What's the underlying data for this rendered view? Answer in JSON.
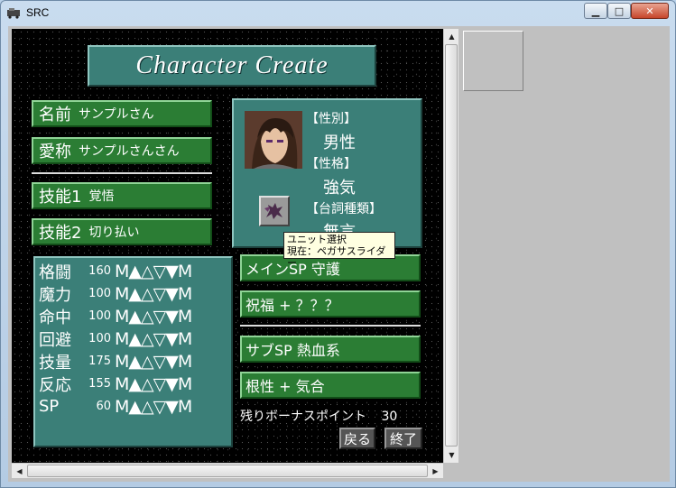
{
  "window": {
    "title": "SRC"
  },
  "header": {
    "title": "Character Create"
  },
  "profile": {
    "name_label": "名前",
    "name_value": "サンプルさん",
    "nickname_label": "愛称",
    "nickname_value": "サンプルさんさん",
    "skill1_label": "技能1",
    "skill1_value": "覚悟",
    "skill2_label": "技能2",
    "skill2_value": "切り払い"
  },
  "portrait_panel": {
    "gender_label": "【性別】",
    "gender_value": "男性",
    "personality_label": "【性格】",
    "personality_value": "強気",
    "dialogue_label": "【台詞種類】",
    "dialogue_value": "無言"
  },
  "tooltip": {
    "line1": "ユニット選択",
    "line2": "現在：ペガサスライダー"
  },
  "stats": [
    {
      "name": "格闘",
      "value": "160"
    },
    {
      "name": "魔力",
      "value": "100"
    },
    {
      "name": "命中",
      "value": "100"
    },
    {
      "name": "回避",
      "value": "100"
    },
    {
      "name": "技量",
      "value": "175"
    },
    {
      "name": "反応",
      "value": "155"
    },
    {
      "name": "SP",
      "value": "60"
    }
  ],
  "stat_controls": {
    "min": "M",
    "up_fast": "▲",
    "up": "△",
    "down": "▽",
    "down_fast": "▼",
    "max": "M"
  },
  "sp": {
    "main": "メインSP  守護",
    "blessing": "祝福 + ？？？",
    "sub": "サブSP   熱血系",
    "grit": "根性 + 気合"
  },
  "bonus": {
    "label": "残りボーナスポイント",
    "value": "30"
  },
  "buttons": {
    "back": "戻る",
    "finish": "終了"
  },
  "colors": {
    "panel_teal": "#3b7f78",
    "button_green": "#2b7d34",
    "background": "#000000"
  }
}
